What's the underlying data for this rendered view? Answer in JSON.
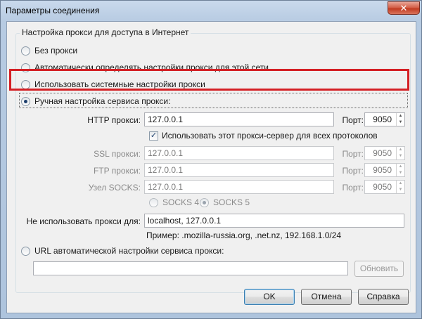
{
  "window": {
    "title": "Параметры соединения",
    "close_glyph": "✕"
  },
  "group_title": "Настройка прокси для доступа в Интернет",
  "radios": {
    "no_proxy": "Без прокси",
    "auto_detect": "Автоматически определять настройки прокси для этой сети",
    "system": "Использовать системные настройки прокси",
    "manual": "Ручная настройка сервиса прокси:",
    "auto_url": "URL автоматической настройки сервиса прокси:"
  },
  "selected_mode": "manual",
  "http": {
    "label": "HTTP прокси:",
    "host": "127.0.0.1",
    "port_label": "Порт:",
    "port": "9050"
  },
  "share_all": {
    "label": "Использовать этот прокси-сервер для всех протоколов",
    "checked": true
  },
  "ssl": {
    "label": "SSL прокси:",
    "host": "127.0.0.1",
    "port_label": "Порт:",
    "port": "9050"
  },
  "ftp": {
    "label": "FTP прокси:",
    "host": "127.0.0.1",
    "port_label": "Порт:",
    "port": "9050"
  },
  "socks": {
    "label": "Узел SOCKS:",
    "host": "127.0.0.1",
    "port_label": "Порт:",
    "port": "9050",
    "v4": "SOCKS 4",
    "v5": "SOCKS 5",
    "selected": "v5"
  },
  "no_proxy_for": {
    "label": "Не использовать прокси для:",
    "value": "localhost, 127.0.0.1",
    "example": "Пример: .mozilla-russia.org, .net.nz, 192.168.1.0/24"
  },
  "auto_url_value": "",
  "buttons": {
    "reload": "Обновить",
    "ok": "OK",
    "cancel": "Отмена",
    "help": "Справка"
  },
  "colors": {
    "highlight": "#d41f24",
    "title_gradient": "#b7cbe2",
    "close": "#c23c22"
  },
  "icons": {
    "close": "close-icon",
    "spin": "spin-arrows-icon",
    "check": "check-icon"
  }
}
